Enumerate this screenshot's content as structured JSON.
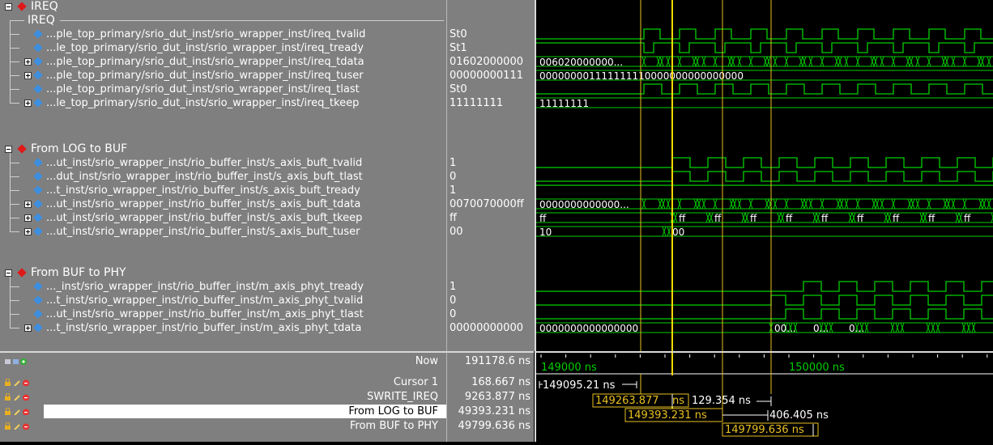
{
  "groups": {
    "ireq": {
      "name": "IREQ",
      "label": "IREQ"
    },
    "log_to_buf": {
      "name": "From LOG to BUF"
    },
    "buf_to_phy": {
      "name": "From BUF to PHY"
    }
  },
  "signals": [
    {
      "path": "...ple_top_primary/srio_dut_inst/srio_wrapper_inst/ireq_tvalid",
      "value": "St0"
    },
    {
      "path": "...le_top_primary/srio_dut_inst/srio_wrapper_inst/ireq_tready",
      "value": "St1"
    },
    {
      "path": "...ple_top_primary/srio_dut_inst/srio_wrapper_inst/ireq_tdata",
      "value": "01602000000"
    },
    {
      "path": "...ple_top_primary/srio_dut_inst/srio_wrapper_inst/ireq_tuser",
      "value": "00000000111"
    },
    {
      "path": "...ple_top_primary/srio_dut_inst/srio_wrapper_inst/ireq_tlast",
      "value": "St0"
    },
    {
      "path": "...le_top_primary/srio_dut_inst/srio_wrapper_inst/ireq_tkeep",
      "value": "11111111"
    },
    {
      "path": "...ut_inst/srio_wrapper_inst/rio_buffer_inst/s_axis_buft_tvalid",
      "value": "1"
    },
    {
      "path": "...dut_inst/srio_wrapper_inst/rio_buffer_inst/s_axis_buft_tlast",
      "value": "0"
    },
    {
      "path": "...t_inst/srio_wrapper_inst/rio_buffer_inst/s_axis_buft_tready",
      "value": "1"
    },
    {
      "path": "...ut_inst/srio_wrapper_inst/rio_buffer_inst/s_axis_buft_tdata",
      "value": "0070070000ff"
    },
    {
      "path": "...ut_inst/srio_wrapper_inst/rio_buffer_inst/s_axis_buft_tkeep",
      "value": "ff"
    },
    {
      "path": "...ut_inst/srio_wrapper_inst/rio_buffer_inst/s_axis_buft_tuser",
      "value": "00"
    },
    {
      "path": "..._inst/srio_wrapper_inst/rio_buffer_inst/m_axis_phyt_tready",
      "value": "1"
    },
    {
      "path": "...t_inst/srio_wrapper_inst/rio_buffer_inst/m_axis_phyt_tvalid",
      "value": "0"
    },
    {
      "path": "...ut_inst/srio_wrapper_inst/rio_buffer_inst/m_axis_phyt_tlast",
      "value": "0"
    },
    {
      "path": "...t_inst/srio_wrapper_inst/rio_buffer_inst/m_axis_phyt_tdata",
      "value": "00000000000"
    }
  ],
  "bus_text": {
    "ireq_tdata": "006020000000...",
    "ireq_tuser": "000000001111111110000000000000000",
    "ireq_tkeep": "11111111",
    "buft_tdata": "0000000000000...",
    "buft_tkeep_first": "ff",
    "buft_tkeep_seg": "ff",
    "buft_tkeep_last": "ff",
    "buft_tuser_first": "10",
    "buft_tuser_second": "00",
    "phyt_tdata": "0000000000000000",
    "phyt_tdata_seg1": "00...",
    "phyt_tdata_seg2": "0...",
    "phyt_tdata_seg3": "0..."
  },
  "cursors": {
    "now": {
      "label": "Now",
      "value": "191178.6 ns"
    },
    "cursor1": {
      "label": "Cursor 1",
      "value": "168.667 ns",
      "readout": "149095.21 ns"
    },
    "swrite_ireq": {
      "label": "SWRITE_IREQ",
      "value": "9263.877 ns",
      "readout_a": "149263.877",
      "readout_b": "ns",
      "delta": "129.354 ns"
    },
    "log_to_buf": {
      "label": "From LOG to BUF",
      "value": "49393.231 ns",
      "readout": "149393.231 ns",
      "delta": "406.405 ns"
    },
    "buf_to_phy": {
      "label": "From BUF to PHY",
      "value": "49799.636 ns",
      "readout": "149799.636 ns"
    }
  },
  "timeline": {
    "tick_a": "149000 ns",
    "tick_b": "150000 ns"
  },
  "colors": {
    "panel": "#7f7f7f",
    "wave": "#00d000",
    "cursor": "#e8c020",
    "cursor_main": "#ffd800"
  },
  "icons": [
    "expand-icon",
    "diamond-icon",
    "lock-icon",
    "wrench-icon",
    "remove-icon",
    "add-icon",
    "monitor-icon"
  ]
}
